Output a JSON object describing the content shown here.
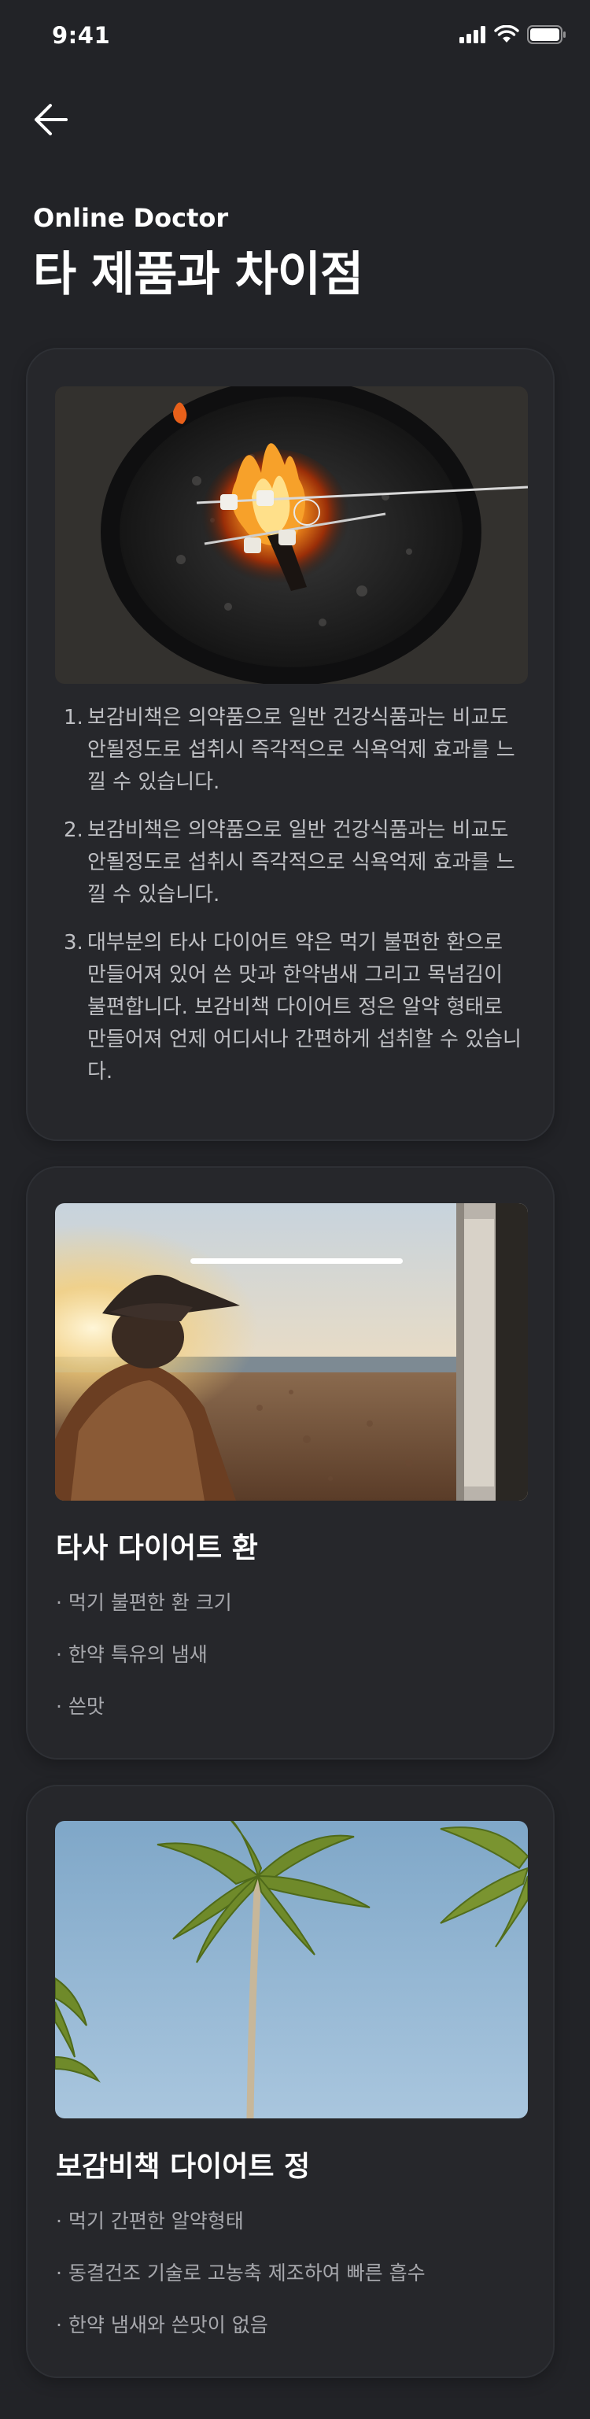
{
  "status_bar": {
    "time": "9:41"
  },
  "header": {
    "subtitle": "Online Doctor",
    "title": "타 제품과 차이점"
  },
  "differences": [
    {
      "num": "1.",
      "text": "보감비책은 의약품으로 일반 건강식품과는 비교도 안될정도로 섭취시 즉각적으로 식욕억제 효과를 느낄 수 있습니다."
    },
    {
      "num": "2.",
      "text": "보감비책은 의약품으로 일반 건강식품과는 비교도 안될정도로 섭취시 즉각적으로 식욕억제 효과를 느낄 수 있습니다."
    },
    {
      "num": "3.",
      "text": "대부분의 타사 다이어트 약은 먹기 불편한 환으로 만들어져 있어 쓴 맛과 한약냄새 그리고 목넘김이 불편합니다. 보감비책 다이어트 정은 알약 형태로 만들어져 언제 어디서나 간편하게 섭취할 수 있습니다."
    }
  ],
  "competitor": {
    "heading": "타사 다이어트 환",
    "items": [
      "· 먹기 불편한 환 크기",
      "· 한약 특유의 냄새",
      "· 쓴맛"
    ]
  },
  "product": {
    "heading": "보감비책 다이어트 정",
    "items": [
      "· 먹기 간편한 알약형태",
      "· 동결건조 기술로 고농축 제조하여 빠른 흡수",
      "· 한약 냄새와 쓴맛이 없음"
    ]
  },
  "colors": {
    "background": "#222327",
    "card": "#26272b",
    "body_text": "#bfc0c4",
    "muted_text": "#a7a8ad"
  },
  "icons": {
    "back": "arrow-left-icon",
    "signal": "cellular-signal-icon",
    "wifi": "wifi-icon",
    "battery": "battery-icon"
  }
}
